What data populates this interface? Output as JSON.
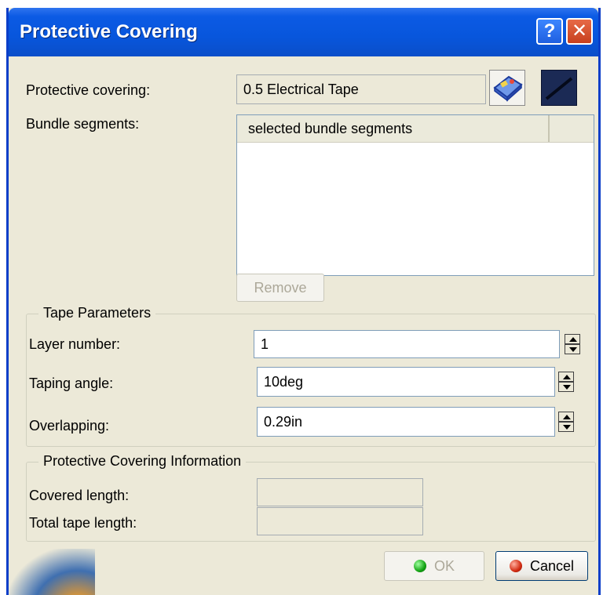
{
  "window": {
    "title": "Protective Covering",
    "help_glyph": "?",
    "close_glyph": "✕"
  },
  "protective_covering": {
    "label": "Protective covering:",
    "value": "0.5 Electrical Tape",
    "catalog_icon": "catalog-browser-icon",
    "line_icon": "line-swatch-icon"
  },
  "bundle_segments": {
    "label": "Bundle segments:",
    "column_header": "selected bundle segments",
    "rows": [],
    "remove_label": "Remove"
  },
  "tape_parameters": {
    "title": "Tape Parameters",
    "layer_number": {
      "label": "Layer number:",
      "value": "1"
    },
    "taping_angle": {
      "label": "Taping angle:",
      "value": "10deg"
    },
    "overlapping": {
      "label": "Overlapping:",
      "value": "0.29in"
    }
  },
  "info": {
    "title": "Protective Covering Information",
    "covered_length": {
      "label": "Covered length:",
      "value": ""
    },
    "total_tape_length": {
      "label": "Total tape length:",
      "value": ""
    }
  },
  "footer": {
    "ok_label": "OK",
    "cancel_label": "Cancel"
  }
}
